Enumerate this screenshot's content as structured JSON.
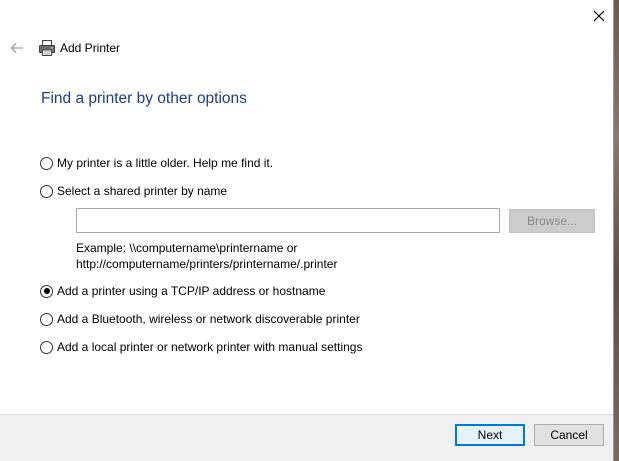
{
  "window": {
    "title": "Add Printer"
  },
  "header": {
    "back_icon": "arrow-left-icon",
    "printer_icon": "printer-icon",
    "title": "Add Printer",
    "close_icon": "close-icon"
  },
  "page": {
    "title": "Find a printer by other options"
  },
  "options": [
    {
      "label": "My printer is a little older. Help me find it.",
      "checked": false
    },
    {
      "label": "Select a shared printer by name",
      "checked": false
    },
    {
      "label": "Add a printer using a TCP/IP address or hostname",
      "checked": true
    },
    {
      "label": "Add a Bluetooth, wireless or network discoverable printer",
      "checked": false
    },
    {
      "label": "Add a local printer or network printer with manual settings",
      "checked": false
    }
  ],
  "shared_printer": {
    "input_value": "",
    "browse_label": "Browse...",
    "example_line1": "Example: \\\\computername\\printername or",
    "example_line2": "http://computername/printers/printername/.printer"
  },
  "footer": {
    "next_label": "Next",
    "cancel_label": "Cancel"
  },
  "colors": {
    "title_blue": "#1a3d8f",
    "focus_blue": "#0078d7",
    "footer_bg": "#f0f0f0"
  }
}
